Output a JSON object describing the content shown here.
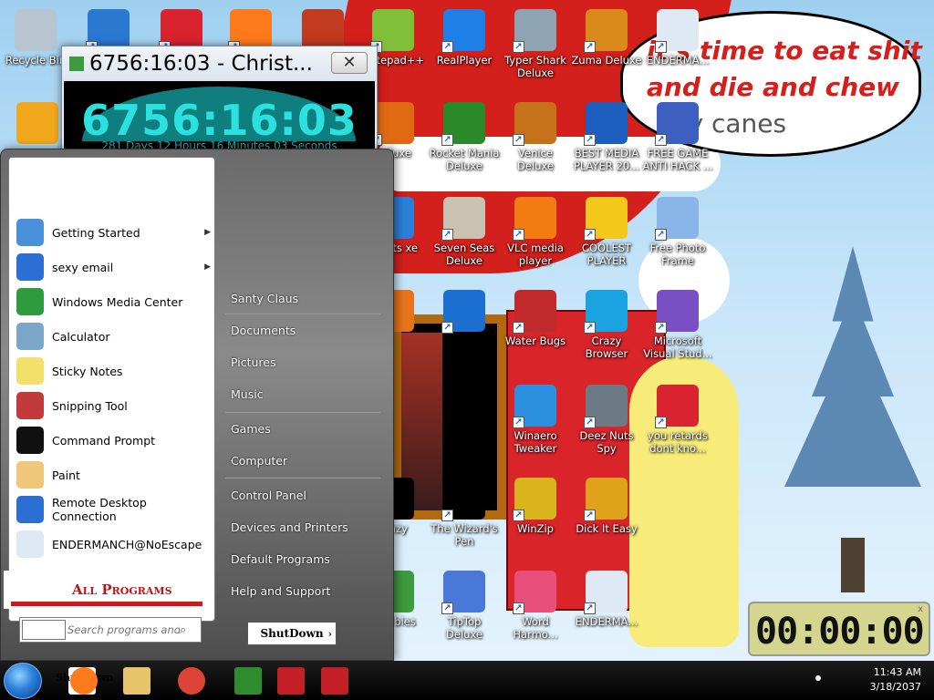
{
  "wallpaper": {
    "speech_bubble": {
      "line1": "it's time to eat shit",
      "line2": "and die and chew",
      "line3": "ndy canes"
    }
  },
  "desktop_icons": [
    {
      "label": "Recycle Bin",
      "icon": "recycle-bin-icon",
      "color": "#b8c4cf",
      "shortcut": false
    },
    {
      "label": "",
      "icon": "two-icon",
      "color": "#2b78d1",
      "shortcut": true
    },
    {
      "label": "",
      "icon": "red-creature-icon",
      "color": "#d9232e",
      "shortcut": true
    },
    {
      "label": "",
      "icon": "firefox-icon",
      "color": "#ff7a1a",
      "shortcut": true
    },
    {
      "label": "",
      "icon": "gate-icon",
      "color": "#c23a1f",
      "shortcut": false
    },
    {
      "label": "Notepad++",
      "icon": "notepad-plus-plus-icon",
      "color": "#7fbf3a",
      "shortcut": true
    },
    {
      "label": "RealPlayer",
      "icon": "realplayer-icon",
      "color": "#1e7fe6",
      "shortcut": true
    },
    {
      "label": "Typer Shark Deluxe",
      "icon": "shark-icon",
      "color": "#8ea4b3",
      "shortcut": true
    },
    {
      "label": "Zuma Deluxe",
      "icon": "zuma-icon",
      "color": "#d98a1a",
      "shortcut": true
    },
    {
      "label": "ENDERMA...",
      "icon": "window-icon",
      "color": "#dfe9f3",
      "shortcut": true
    },
    {
      "label": "",
      "icon": "ark-icon",
      "color": "#f2a81c",
      "shortcut": false
    },
    {
      "label": "Deluxe",
      "icon": "p-icon",
      "color": "#e06a12",
      "shortcut": true
    },
    {
      "label": "Rocket Mania Deluxe",
      "icon": "rocket-icon",
      "color": "#2a8a2a",
      "shortcut": true
    },
    {
      "label": "Venice Deluxe",
      "icon": "venice-icon",
      "color": "#c5721a",
      "shortcut": true
    },
    {
      "label": "BEST MEDIA PLAYER 20...",
      "icon": "xm-play-icon",
      "color": "#1c5fbf",
      "shortcut": true
    },
    {
      "label": "FREE GAME ANTI HACK ...",
      "icon": "globe-person-icon",
      "color": "#3d5fbf",
      "shortcut": true
    },
    {
      "label": "Nights xe",
      "icon": "blue-swirl-icon",
      "color": "#2c7fd9",
      "shortcut": true
    },
    {
      "label": "Seven Seas Deluxe",
      "icon": "skull-icon",
      "color": "#c9c2b0",
      "shortcut": true
    },
    {
      "label": "VLC media player",
      "icon": "vlc-cone-icon",
      "color": "#f27b12",
      "shortcut": true
    },
    {
      "label": "COOLEST PLAYER",
      "icon": "smiley-icon",
      "color": "#f2c81c",
      "shortcut": true
    },
    {
      "label": "Free Photo Frame",
      "icon": "photo-frame-icon",
      "color": "#8ab5e8",
      "shortcut": true
    },
    {
      "label": "",
      "icon": "orange-ball-icon",
      "color": "#e8731a",
      "shortcut": false
    },
    {
      "label": "",
      "icon": "blue-bird-icon",
      "color": "#1a6fd1",
      "shortcut": true
    },
    {
      "label": "Water Bugs",
      "icon": "porthole-icon",
      "color": "#c02a2a",
      "shortcut": true
    },
    {
      "label": "Crazy Browser",
      "icon": "star-icon",
      "color": "#1aa3e0",
      "shortcut": true
    },
    {
      "label": "Microsoft Visual Stud...",
      "icon": "infinity-icon",
      "color": "#7b4fc4",
      "shortcut": true
    },
    {
      "label": "Winaero Tweaker",
      "icon": "winaero-icon",
      "color": "#2c8fe0",
      "shortcut": true
    },
    {
      "label": "Deez Nuts Spy",
      "icon": "windows-stack-icon",
      "color": "#6c7a85",
      "shortcut": true
    },
    {
      "label": "you retards dont kno...",
      "icon": "red-face-icon",
      "color": "#d9232e",
      "shortcut": true
    },
    {
      "label": "renzy",
      "icon": "frenzy-icon",
      "color": "#000000",
      "shortcut": true
    },
    {
      "label": "The Wizard's Pen",
      "icon": "wizard-icon",
      "color": "#000000",
      "shortcut": true
    },
    {
      "label": "WinZip",
      "icon": "winzip-icon",
      "color": "#d9b41c",
      "shortcut": true
    },
    {
      "label": "Dick It Easy",
      "icon": "de-icon",
      "color": "#e0a21a",
      "shortcut": true
    },
    {
      "label": "s vs bies",
      "icon": "plant-icon",
      "color": "#3d9a3d",
      "shortcut": true
    },
    {
      "label": "TipTop Deluxe",
      "icon": "cocktail-icon",
      "color": "#4a78d8",
      "shortcut": true
    },
    {
      "label": "Word Harmo...",
      "icon": "flower-icon",
      "color": "#e84f7a",
      "shortcut": true
    },
    {
      "label": "ENDERMA...",
      "icon": "window-icon",
      "color": "#dfe9f3",
      "shortcut": true
    }
  ],
  "countdown_window": {
    "title": "6756:16:03 - Christ...",
    "time": "6756:16:03",
    "subtitle": "281 Days 12 Hours 16 Minutes 03 Seconds",
    "close_label": "✕"
  },
  "start_menu": {
    "left_items": [
      {
        "label": "Getting Started",
        "icon": "getting-started-icon",
        "color": "#4a90d9",
        "arrow": true
      },
      {
        "label": "sexy email",
        "icon": "thunderbird-icon",
        "color": "#2a6fd1",
        "arrow": true
      },
      {
        "label": "Windows Media Center",
        "icon": "media-center-icon",
        "color": "#2e9b3e",
        "arrow": false
      },
      {
        "label": "Calculator",
        "icon": "calculator-icon",
        "color": "#7aa7c7",
        "arrow": false
      },
      {
        "label": "Sticky Notes",
        "icon": "sticky-notes-icon",
        "color": "#f2e06a",
        "arrow": false
      },
      {
        "label": "Snipping Tool",
        "icon": "scissors-icon",
        "color": "#c23a3a",
        "arrow": false
      },
      {
        "label": "Command Prompt",
        "icon": "command-prompt-icon",
        "color": "#111111",
        "arrow": false
      },
      {
        "label": "Paint",
        "icon": "paint-palette-icon",
        "color": "#f0c67a",
        "arrow": false
      },
      {
        "label": "Remote Desktop Connection",
        "icon": "remote-desktop-icon",
        "color": "#2a6fd1",
        "arrow": false
      },
      {
        "label": "ENDERMANCH@NoEscape",
        "icon": "window-icon",
        "color": "#dfe9f3",
        "arrow": false
      }
    ],
    "all_programs_label": "All Programs",
    "search_placeholder": "Search programs and files",
    "right_items": [
      "Santy Claus",
      "Documents",
      "Pictures",
      "Music",
      "Games",
      "Computer",
      "Control Panel",
      "Devices and Printers",
      "Default Programs",
      "Help and Support"
    ],
    "shutdown_label": "ShutDown"
  },
  "timer_widget": {
    "display": "00:00:00",
    "close_label": "x"
  },
  "taskbar": {
    "items": [
      {
        "name": "shutdown-taskbar-button",
        "label": "ShutDown",
        "icon": "shutdown-icon",
        "color": "#ffffff"
      },
      {
        "name": "firefox-taskbar-button",
        "label": "",
        "icon": "firefox-icon",
        "color": "#ff7a1a"
      },
      {
        "name": "explorer-taskbar-button",
        "label": "",
        "icon": "folder-icon",
        "color": "#e8c46a"
      },
      {
        "name": "chrome-taskbar-button",
        "label": "",
        "icon": "chrome-icon",
        "color": "#db4437"
      },
      {
        "name": "christmas-app-taskbar-button",
        "label": "",
        "icon": "christmas-tree-icon",
        "color": "#2e8b2e"
      },
      {
        "name": "red-app-taskbar-button-1",
        "label": "",
        "icon": "red-window-icon",
        "color": "#c21f26"
      },
      {
        "name": "red-app-taskbar-button-2",
        "label": "",
        "icon": "red-window-icon",
        "color": "#c21f26"
      }
    ],
    "clock_time": "11:43 AM",
    "clock_date": "3/18/2037"
  }
}
